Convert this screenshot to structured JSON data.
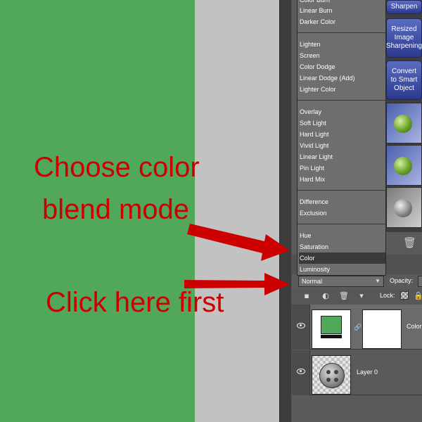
{
  "blend_menu": {
    "items": [
      {
        "label": "Color Burn"
      },
      {
        "label": "Linear Burn"
      },
      {
        "label": "Darker Color"
      },
      {
        "label": "Lighten"
      },
      {
        "label": "Screen"
      },
      {
        "label": "Color Dodge"
      },
      {
        "label": "Linear Dodge (Add)"
      },
      {
        "label": "Lighter Color"
      },
      {
        "label": "Overlay"
      },
      {
        "label": "Soft Light"
      },
      {
        "label": "Hard Light"
      },
      {
        "label": "Vivid Light"
      },
      {
        "label": "Linear Light"
      },
      {
        "label": "Pin Light"
      },
      {
        "label": "Hard Mix"
      },
      {
        "label": "Difference"
      },
      {
        "label": "Exclusion"
      },
      {
        "label": "Hue"
      },
      {
        "label": "Saturation"
      },
      {
        "label": "Color"
      },
      {
        "label": "Luminosity"
      }
    ],
    "selected": "Color"
  },
  "actions": {
    "sharpen_label": "Sharpen",
    "resized_label": "Resized Image Sharpening",
    "smart_label": "Convert to Smart Object"
  },
  "layers_panel": {
    "blend_mode_value": "Normal",
    "opacity_label": "Opacity:",
    "lock_label": "Lock:",
    "layers": [
      {
        "name": "Color"
      },
      {
        "name": "Layer 0"
      }
    ]
  },
  "annotations": {
    "choose_line1": "Choose color",
    "choose_line2": "blend mode",
    "click_first": "Click here first",
    "color": "#cc0000"
  },
  "colors": {
    "canvas_green": "#52a85a",
    "canvas_gray": "#c2c2c2",
    "panel_dark": "#5a5a5a"
  }
}
